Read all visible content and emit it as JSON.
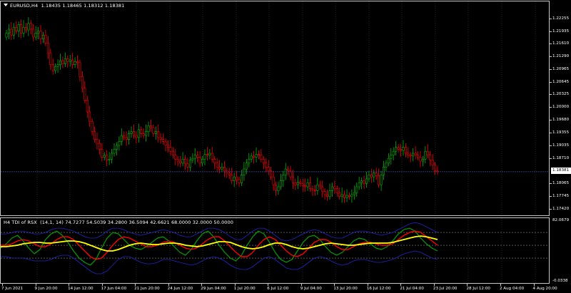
{
  "window": {
    "symbol_label": "EURUSD,H4  1.18435 1.18465 1.18312 1.18381",
    "indicator_label": "H4 TDI of RSX  (14,1, 14) 74.7277 54.5039 34.2800 36.5094 42.6621 68.0000 32.0000 50.0000",
    "current_price": "1.18381"
  },
  "price_axis": [
    "1.22255",
    "1.21935",
    "1.21610",
    "1.21290",
    "1.20965",
    "1.20645",
    "1.20325",
    "1.20000",
    "1.19680",
    "1.19355",
    "1.19035",
    "1.18710",
    "1.18381",
    "1.18065",
    "1.17745",
    "1.17420"
  ],
  "indicator_axis": [
    "82.0679",
    "-0.0338"
  ],
  "time_axis": [
    "7 Jun 2021",
    "9 Jun 20:00",
    "14 Jun 12:00",
    "17 Jun 04:00",
    "21 Jun 20:00",
    "24 Jun 12:00",
    "29 Jun 04:00",
    "1 Jul 20:00",
    "6 Jul 12:00",
    "9 Jul 04:00",
    "13 Jul 20:00",
    "16 Jul 12:00",
    "21 Jul 04:00",
    "23 Jul 20:00",
    "28 Jul 12:00",
    "2 Aug 04:00",
    "4 Aug 20:00"
  ],
  "colors": {
    "bull": "#00b400",
    "bear": "#ff0000",
    "grid": "#3a3a3a",
    "bid_line": "#3c4ba0",
    "band": "#2323c8",
    "level": "#8a8a8a",
    "tdi_green": "#00a000",
    "tdi_red": "#ff0000",
    "tdi_yellow": "#ffff00"
  },
  "chart_data": [
    {
      "type": "candlestick",
      "symbol": "EURUSD",
      "timeframe": "H4",
      "ylim": [
        1.1742,
        1.2256
      ],
      "last": 1.18381,
      "closes": [
        1.219,
        1.22,
        1.2185,
        1.2205,
        1.2195,
        1.2212,
        1.219,
        1.2205,
        1.2198,
        1.2215,
        1.22,
        1.218,
        1.219,
        1.2195,
        1.2175,
        1.2185,
        1.2165,
        1.214,
        1.211,
        1.2095,
        1.2105,
        1.211,
        1.212,
        1.2112,
        1.2125,
        1.2118,
        1.2122,
        1.211,
        1.2118,
        1.2115,
        1.208,
        1.205,
        1.202,
        1.199,
        1.1965,
        1.194,
        1.192,
        1.191,
        1.1895,
        1.1875,
        1.188,
        1.1868,
        1.187,
        1.1885,
        1.1895,
        1.1905,
        1.1915,
        1.193,
        1.1925,
        1.192,
        1.1935,
        1.194,
        1.193,
        1.1925,
        1.1945,
        1.1935,
        1.193,
        1.194,
        1.1955,
        1.195,
        1.1935,
        1.194,
        1.1925,
        1.192,
        1.1915,
        1.1905,
        1.19,
        1.189,
        1.188,
        1.187,
        1.1865,
        1.186,
        1.187,
        1.1858,
        1.185,
        1.1868,
        1.1872,
        1.188,
        1.1875,
        1.186,
        1.187,
        1.1882,
        1.188,
        1.1885,
        1.187,
        1.186,
        1.185,
        1.1845,
        1.185,
        1.184,
        1.1835,
        1.183,
        1.1815,
        1.1825,
        1.1818,
        1.181,
        1.183,
        1.1845,
        1.186,
        1.187,
        1.1878,
        1.1875,
        1.1882,
        1.188,
        1.187,
        1.186,
        1.185,
        1.184,
        1.1825,
        1.1805,
        1.179,
        1.18,
        1.1815,
        1.183,
        1.1845,
        1.184,
        1.1825,
        1.181,
        1.1805,
        1.1812,
        1.1808,
        1.1803,
        1.18,
        1.181,
        1.1795,
        1.1792,
        1.179,
        1.1805,
        1.18,
        1.1788,
        1.178,
        1.1775,
        1.179,
        1.18,
        1.1795,
        1.1785,
        1.1775,
        1.178,
        1.1772,
        1.1778,
        1.1775,
        1.178,
        1.1785,
        1.18,
        1.181,
        1.1815,
        1.1808,
        1.182,
        1.183,
        1.1825,
        1.1835,
        1.1828,
        1.1805,
        1.183,
        1.185,
        1.186,
        1.1872,
        1.188,
        1.189,
        1.19,
        1.1895,
        1.1892,
        1.19,
        1.1885,
        1.188,
        1.1878,
        1.1885,
        1.188,
        1.1875,
        1.1865,
        1.187,
        1.189,
        1.188,
        1.1868,
        1.1855,
        1.184,
        1.1838
      ]
    },
    {
      "type": "line",
      "name": "TDI of RSX",
      "ylim": [
        -0.0338,
        82.0679
      ],
      "levels": [
        68,
        50,
        32
      ],
      "series": [
        {
          "name": "green",
          "values": [
            46,
            52,
            60,
            64,
            56,
            46,
            38,
            44,
            58,
            66,
            70,
            64,
            54,
            42,
            32,
            26,
            22,
            30,
            46,
            60,
            68,
            66,
            58,
            50,
            46,
            44,
            48,
            54,
            60,
            62,
            56,
            48,
            40,
            36,
            44,
            56,
            66,
            70,
            62,
            50,
            40,
            32,
            28,
            36,
            50,
            62,
            70,
            66,
            54,
            40,
            30,
            26,
            30,
            42,
            54,
            62,
            64,
            58,
            48,
            40,
            36,
            40,
            48,
            56,
            60,
            58,
            52,
            46,
            44,
            48,
            56,
            66,
            72,
            74,
            70,
            60,
            52,
            46,
            42
          ]
        },
        {
          "name": "red",
          "values": [
            50,
            50,
            52,
            56,
            58,
            56,
            52,
            48,
            48,
            52,
            58,
            62,
            62,
            58,
            50,
            42,
            34,
            30,
            32,
            40,
            50,
            58,
            62,
            60,
            56,
            52,
            48,
            48,
            50,
            54,
            56,
            54,
            50,
            46,
            44,
            46,
            52,
            58,
            62,
            62,
            56,
            48,
            40,
            34,
            34,
            40,
            50,
            58,
            62,
            58,
            50,
            42,
            36,
            34,
            38,
            46,
            54,
            58,
            58,
            54,
            48,
            44,
            44,
            48,
            52,
            54,
            54,
            52,
            50,
            50,
            52,
            58,
            64,
            68,
            70,
            68,
            62,
            56,
            50
          ]
        },
        {
          "name": "yellow",
          "values": [
            48,
            48,
            49,
            50,
            52,
            53,
            54,
            54,
            53,
            53,
            54,
            55,
            56,
            56,
            55,
            53,
            50,
            47,
            44,
            42,
            42,
            44,
            47,
            50,
            52,
            53,
            52,
            51,
            51,
            52,
            53,
            53,
            52,
            50,
            49,
            48,
            49,
            51,
            53,
            55,
            55,
            54,
            51,
            48,
            46,
            45,
            46,
            48,
            51,
            53,
            53,
            51,
            48,
            46,
            45,
            46,
            48,
            50,
            52,
            53,
            52,
            51,
            50,
            50,
            51,
            52,
            53,
            53,
            53,
            53,
            54,
            56,
            58,
            60,
            62,
            63,
            62,
            60,
            58
          ]
        },
        {
          "name": "upper-band",
          "values": [
            66,
            66,
            68,
            70,
            70,
            68,
            66,
            66,
            68,
            72,
            74,
            74,
            72,
            70,
            66,
            62,
            60,
            60,
            64,
            70,
            74,
            74,
            72,
            68,
            66,
            64,
            66,
            68,
            70,
            72,
            70,
            68,
            64,
            62,
            62,
            66,
            70,
            74,
            74,
            72,
            68,
            62,
            58,
            58,
            64,
            70,
            74,
            74,
            70,
            64,
            58,
            56,
            58,
            62,
            66,
            70,
            72,
            70,
            66,
            62,
            60,
            60,
            64,
            68,
            70,
            70,
            68,
            66,
            64,
            66,
            68,
            72,
            76,
            80,
            82,
            80,
            76,
            72,
            68
          ]
        },
        {
          "name": "lower-band",
          "values": [
            34,
            34,
            32,
            32,
            32,
            30,
            28,
            28,
            28,
            30,
            34,
            36,
            36,
            32,
            26,
            20,
            14,
            10,
            10,
            14,
            22,
            30,
            34,
            34,
            30,
            26,
            24,
            24,
            26,
            30,
            30,
            28,
            26,
            24,
            22,
            24,
            28,
            32,
            34,
            32,
            28,
            22,
            18,
            16,
            16,
            20,
            26,
            32,
            34,
            30,
            24,
            18,
            16,
            16,
            20,
            26,
            32,
            34,
            32,
            28,
            24,
            22,
            24,
            28,
            30,
            30,
            28,
            26,
            26,
            28,
            30,
            34,
            38,
            40,
            42,
            40,
            36,
            32,
            30
          ]
        }
      ]
    }
  ]
}
